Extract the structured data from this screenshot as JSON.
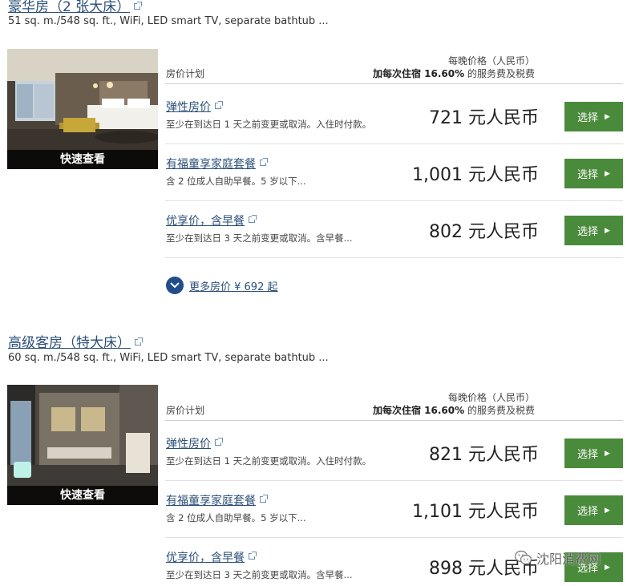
{
  "rooms": [
    {
      "title": "豪华房（2 张大床）",
      "description": "51 sq. m./548 sq. ft., WiFi, LED smart TV, separate bathtub ...",
      "quick_view": "快速查看",
      "header": {
        "plan_label": "房价计划",
        "price_label": "每晚价格（人民币）",
        "fee_bold": "加每次住宿 16.60%",
        "fee_rest": " 的服务费及税费"
      },
      "rates": [
        {
          "name": "弹性房价",
          "note": "至少在到达日 1 天之前变更或取消。入住时付款。",
          "price": "721 元人民币",
          "button": "选择"
        },
        {
          "name": "有福童享家庭套餐",
          "note": "含 2 位成人自助早餐。5 岁以下...",
          "price": "1,001 元人民币",
          "button": "选择"
        },
        {
          "name": "优享价，含早餐",
          "note": "至少在到达日 3 天之前变更或取消。含早餐...",
          "price": "802 元人民币",
          "button": "选择"
        }
      ],
      "more_rates": "更多房价 ¥ 692 起"
    },
    {
      "title": "高级客房（特大床）",
      "description": "60 sq. m./548 sq. ft., WiFi, LED smart TV, separate bathtub ...",
      "quick_view": "快速查看",
      "header": {
        "plan_label": "房价计划",
        "price_label": "每晚价格（人民币）",
        "fee_bold": "加每次住宿 16.60%",
        "fee_rest": " 的服务费及税费"
      },
      "rates": [
        {
          "name": "弹性房价",
          "note": "至少在到达日 1 天之前变更或取消。入住时付款。",
          "price": "821 元人民币",
          "button": "选择"
        },
        {
          "name": "有福童享家庭套餐",
          "note": "含 2 位成人自助早餐。5 岁以下...",
          "price": "1,101 元人民币",
          "button": "选择"
        },
        {
          "name": "优享价，含早餐",
          "note": "至少在到达日 3 天之前变更或取消。含早餐...",
          "price": "898 元人民币",
          "button": "选择"
        }
      ]
    }
  ],
  "watermark": "沈阳消费网",
  "colors": {
    "link": "#2a4f7a",
    "button": "#4a8a3b",
    "chevron_circle": "#1f4e8a"
  },
  "icons": {
    "external_link": "external-link-icon",
    "chevron_down": "chevron-down-icon",
    "arrow_right": "arrow-right-icon",
    "wechat": "wechat-icon"
  }
}
